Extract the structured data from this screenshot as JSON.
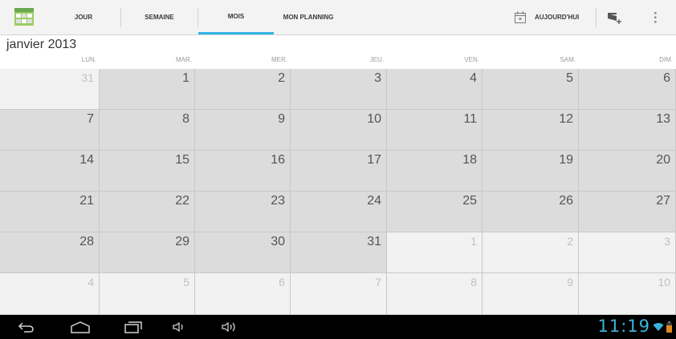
{
  "tabs": [
    {
      "label": "JOUR"
    },
    {
      "label": "SEMAINE"
    },
    {
      "label": "MOIS"
    },
    {
      "label": "MON PLANNING"
    }
  ],
  "today_button": {
    "label": "AUJOURD'HUI"
  },
  "month_title": "janvier 2013",
  "weekdays": [
    "LUN.",
    "MAR.",
    "MER.",
    "JEU.",
    "VEN.",
    "SAM.",
    "DIM."
  ],
  "weeks": [
    [
      "31",
      "1",
      "2",
      "3",
      "4",
      "5",
      "6"
    ],
    [
      "7",
      "8",
      "9",
      "10",
      "11",
      "12",
      "13"
    ],
    [
      "14",
      "15",
      "16",
      "17",
      "18",
      "19",
      "20"
    ],
    [
      "21",
      "22",
      "23",
      "24",
      "25",
      "26",
      "27"
    ],
    [
      "28",
      "29",
      "30",
      "31",
      "1",
      "2",
      "3"
    ],
    [
      "4",
      "5",
      "6",
      "7",
      "8",
      "9",
      "10"
    ]
  ],
  "in_month": [
    [
      false,
      true,
      true,
      true,
      true,
      true,
      true
    ],
    [
      true,
      true,
      true,
      true,
      true,
      true,
      true
    ],
    [
      true,
      true,
      true,
      true,
      true,
      true,
      true
    ],
    [
      true,
      true,
      true,
      true,
      true,
      true,
      true
    ],
    [
      true,
      true,
      true,
      true,
      false,
      false,
      false
    ],
    [
      false,
      false,
      false,
      false,
      false,
      false,
      false
    ]
  ],
  "status": {
    "time": "11:19"
  },
  "colors": {
    "accent": "#33b5e5",
    "clock": "#3ab4dc",
    "battery": "#e08a1e"
  },
  "icons": {
    "app": "calendar-app-icon",
    "today": "calendar-today-icon",
    "new_event": "new-event-icon",
    "overflow": "overflow-menu-icon",
    "back": "back-icon",
    "home": "home-icon",
    "recents": "recent-apps-icon",
    "volume_down": "volume-down-icon",
    "volume_up": "volume-up-icon",
    "wifi": "wifi-icon",
    "battery": "battery-icon"
  }
}
